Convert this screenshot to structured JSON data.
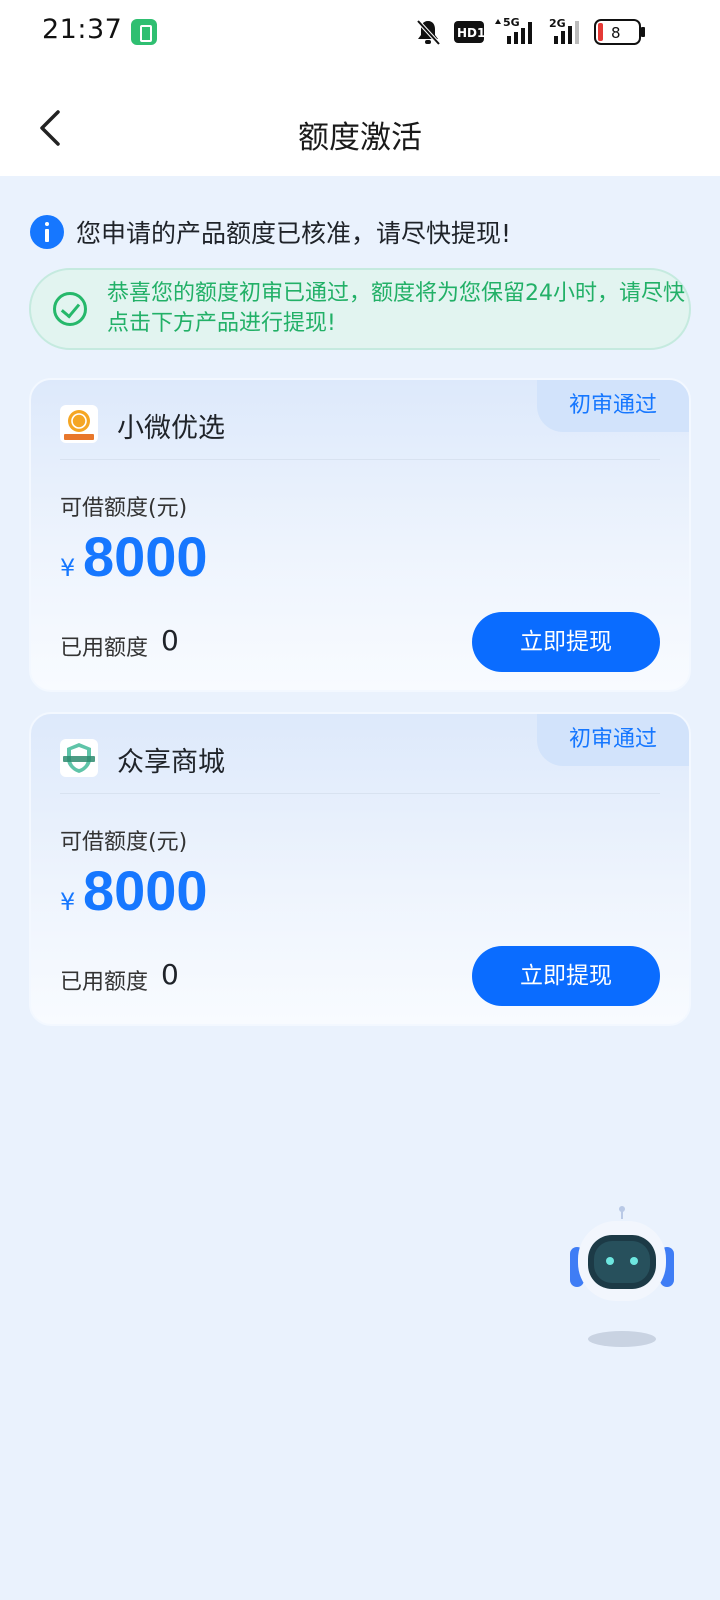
{
  "status_bar": {
    "time": "21:37",
    "battery_level": "8",
    "network_1": "5G",
    "network_2": "2G",
    "hd_label": "HD1"
  },
  "header": {
    "title": "额度激活"
  },
  "notice": {
    "text": "您申请的产品额度已核准，请尽快提现!"
  },
  "success_banner": {
    "text": "恭喜您的额度初审已通过，额度将为您保留24小时，请尽快点击下方产品进行提现!"
  },
  "products": [
    {
      "name": "小微优选",
      "logo_text": "小微优选",
      "badge": "初审通过",
      "amount_label": "可借额度(元)",
      "currency": "¥",
      "amount": "8000",
      "used_label": "已用额度",
      "used_value": "0",
      "button_label": "立即提现"
    },
    {
      "name": "众享商城",
      "logo_text": "众享商城",
      "badge": "初审通过",
      "amount_label": "可借额度(元)",
      "currency": "¥",
      "amount": "8000",
      "used_label": "已用额度",
      "used_value": "0",
      "button_label": "立即提现"
    }
  ],
  "colors": {
    "accent": "#1677ff",
    "success": "#22b067",
    "background": "#eaf2fd"
  }
}
